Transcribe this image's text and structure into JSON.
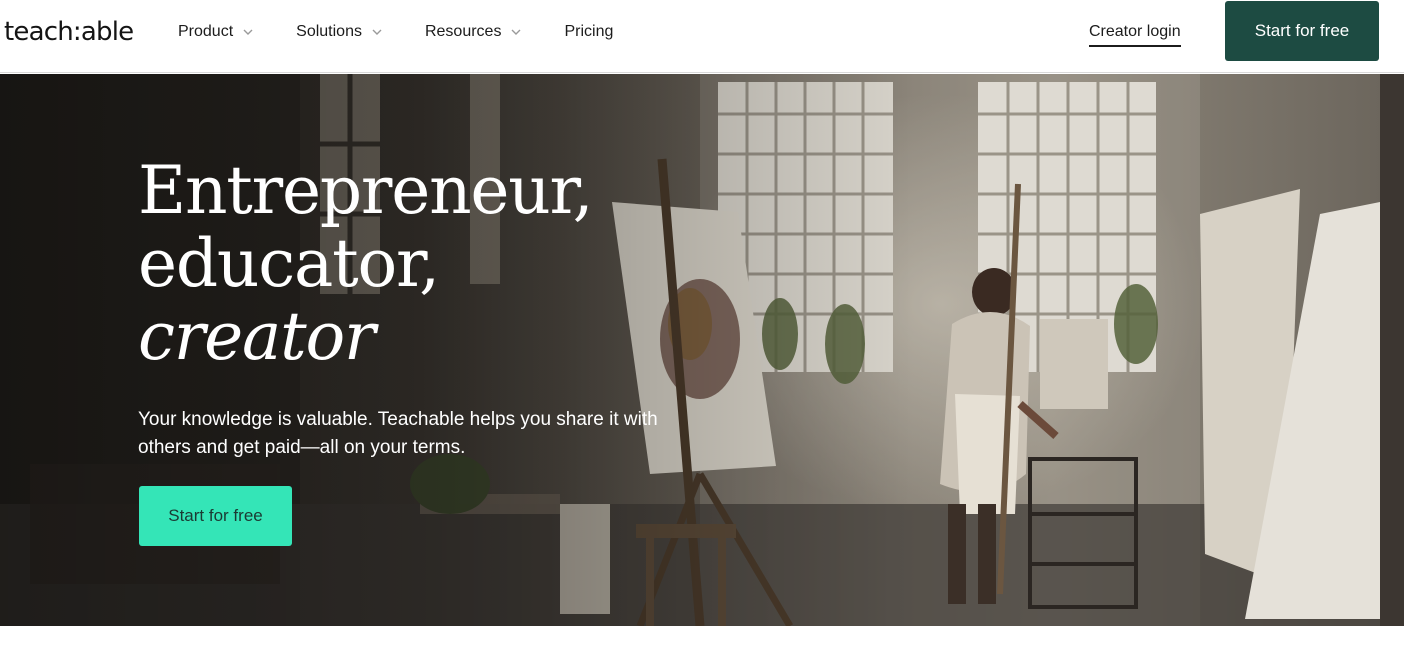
{
  "header": {
    "logo": "teach:able",
    "nav": [
      {
        "label": "Product",
        "has_dropdown": true
      },
      {
        "label": "Solutions",
        "has_dropdown": true
      },
      {
        "label": "Resources",
        "has_dropdown": true
      },
      {
        "label": "Pricing",
        "has_dropdown": false
      }
    ],
    "login_label": "Creator login",
    "cta_label": "Start for free"
  },
  "hero": {
    "headline": {
      "line1": "Entrepreneur,",
      "line2": "educator,",
      "line3": "creator"
    },
    "subtext": "Your knowledge is valuable. Teachable helps you share it with others and get paid—all on your terms.",
    "cta_label": "Start for free"
  },
  "colors": {
    "header_cta_bg": "#1d4b42",
    "hero_cta_bg": "#34e5b7",
    "text_dark": "#1c1c1c"
  },
  "icons": {
    "dropdown": "chevron-down-icon"
  }
}
